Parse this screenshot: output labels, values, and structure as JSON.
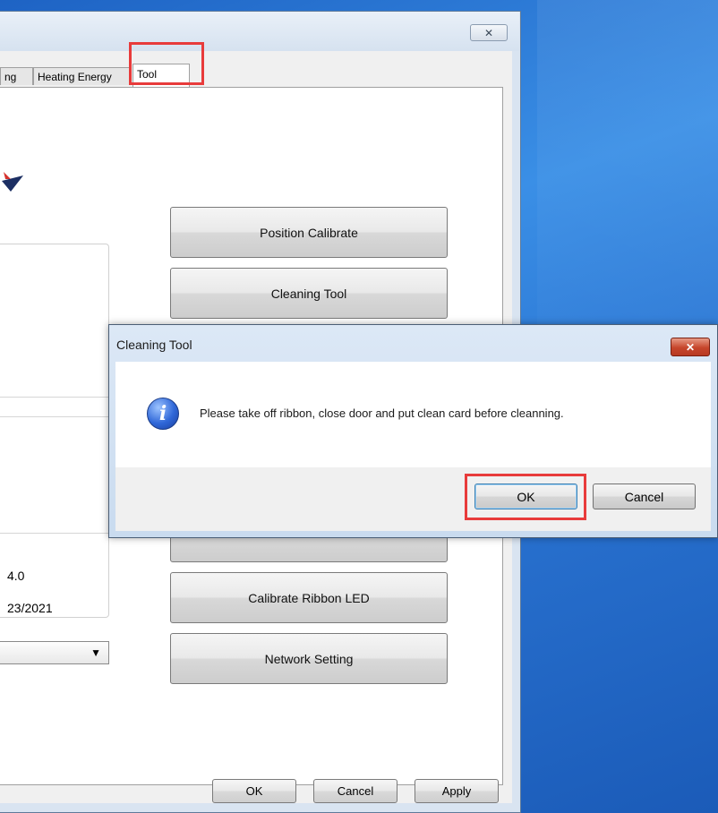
{
  "main_window": {
    "close_glyph": "✕",
    "tabs": [
      {
        "label": "ng"
      },
      {
        "label": "Heating Energy"
      },
      {
        "label": "Tool"
      }
    ],
    "info": {
      "version_value": "4.0",
      "date_value": "23/2021"
    },
    "combo_value": "",
    "tool_buttons": [
      {
        "label": "Position Calibrate"
      },
      {
        "label": "Cleaning Tool"
      },
      {
        "label": ""
      },
      {
        "label": ""
      },
      {
        "label": ""
      },
      {
        "label": "Calibrate Ribbon LED"
      },
      {
        "label": "Network Setting"
      }
    ],
    "footer": {
      "ok_label": "OK",
      "cancel_label": "Cancel",
      "apply_label": "Apply"
    }
  },
  "dialog": {
    "title": "Cleaning Tool",
    "close_glyph": "✕",
    "icon_glyph": "i",
    "message": "Please take off ribbon, close door and put clean card before cleanning.",
    "ok_label": "OK",
    "cancel_label": "Cancel"
  },
  "colors": {
    "highlight": "#e83b3b",
    "desktop": "#2b7fd6",
    "dialog_close": "#c6452b"
  }
}
